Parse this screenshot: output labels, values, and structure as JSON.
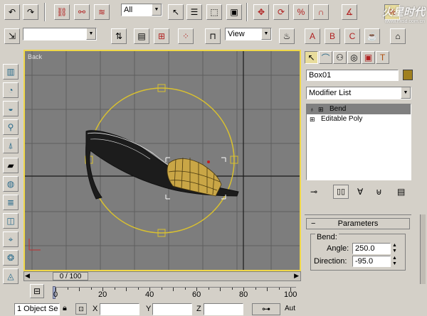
{
  "toolbar": {
    "selection_filter": "All",
    "reference_coord": "View"
  },
  "watermark": {
    "brand": "火星时代",
    "url": "www.hxsd.com.cn"
  },
  "viewport": {
    "label": "Back"
  },
  "command_panel": {
    "object_name": "Box01",
    "object_color": "#a08020",
    "modifier_list_label": "Modifier List",
    "stack": [
      {
        "label": "Bend",
        "selected": true
      },
      {
        "label": "Editable Poly",
        "selected": false
      }
    ],
    "parameters": {
      "rollout_title": "Parameters",
      "group_label": "Bend:",
      "angle_label": "Angle:",
      "angle_value": "250.0",
      "direction_label": "Direction:",
      "direction_value": "-95.0"
    }
  },
  "timeline": {
    "frame_counter": "0 / 100",
    "ticks": [
      "0",
      "20",
      "40",
      "60",
      "80",
      "100"
    ]
  },
  "status_bar": {
    "selection_text": "1 Object Se",
    "x_label": "X",
    "y_label": "Y",
    "z_label": "Z",
    "auto_key": "Aut"
  },
  "colors": {
    "ui_gray": "#d4d0c8",
    "viewport_bg": "#7d7d7d",
    "active_viewport_border": "#f0d848",
    "gizmo": "#d8c030"
  }
}
